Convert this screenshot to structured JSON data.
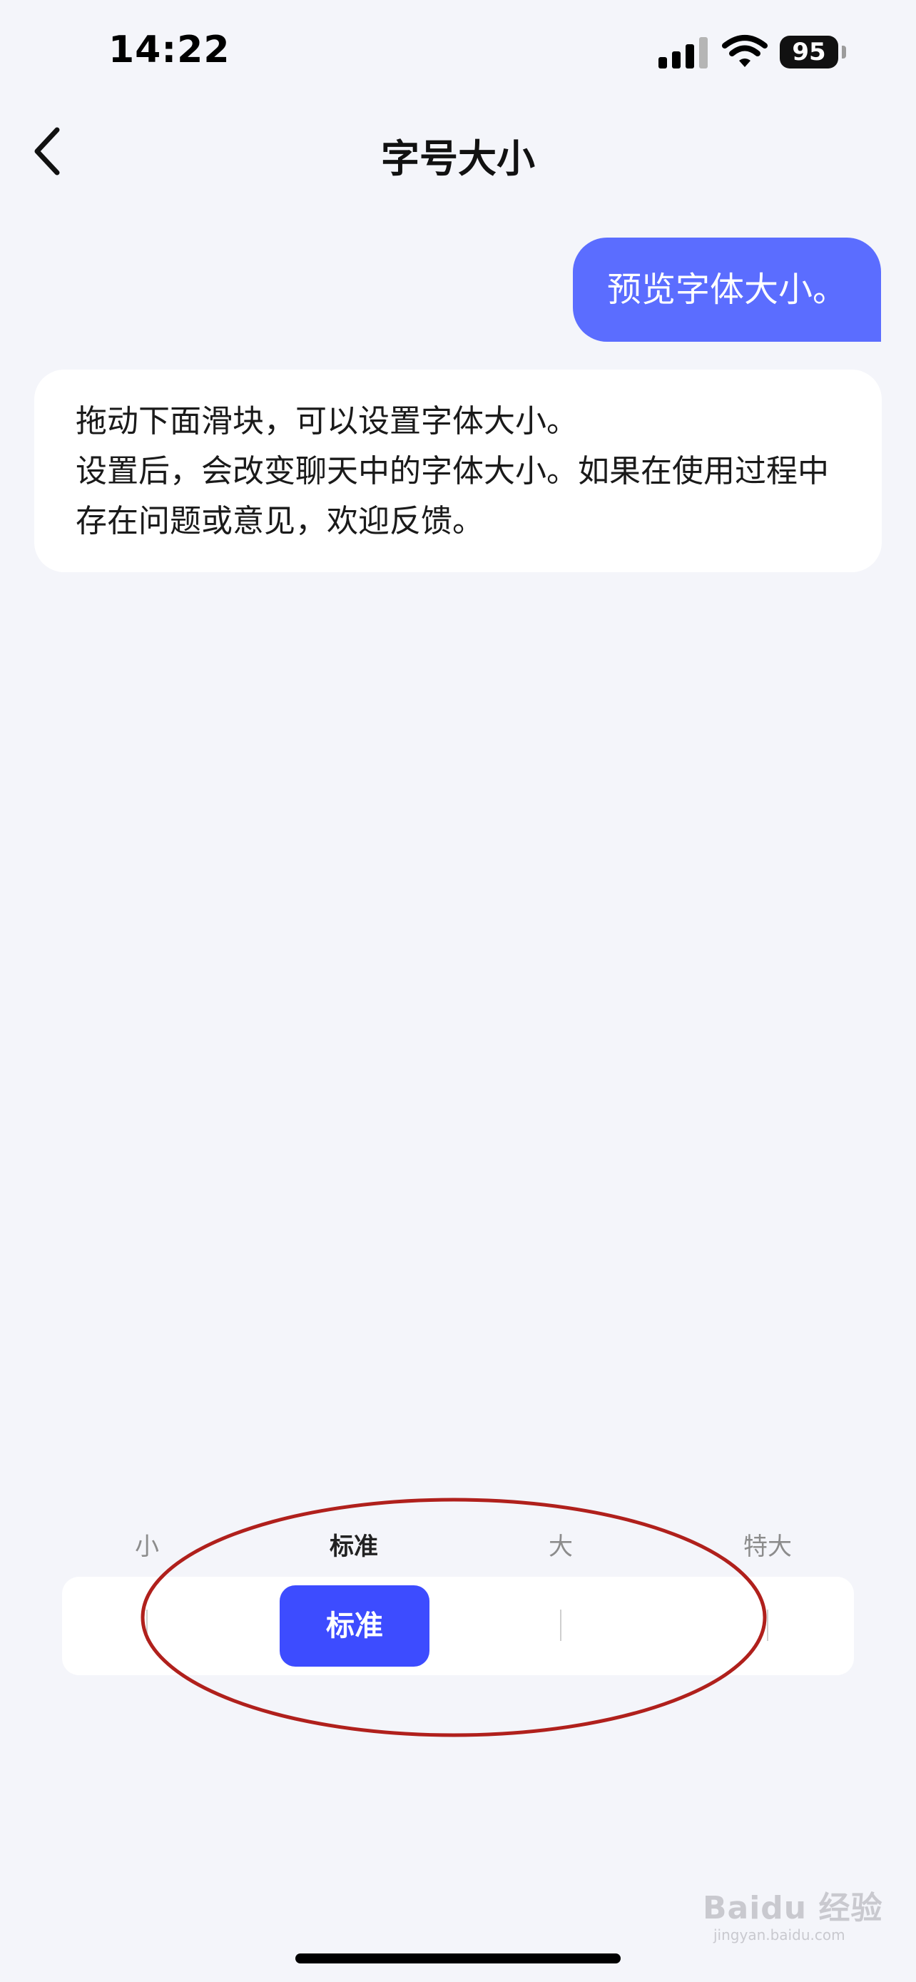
{
  "status": {
    "time": "14:22",
    "battery": "95"
  },
  "nav": {
    "title": "字号大小"
  },
  "chat": {
    "preview_bubble": "预览字体大小。",
    "info_bubble": "拖动下面滑块，可以设置字体大小。\n设置后，会改变聊天中的字体大小。如果在使用过程中存在问题或意见，欢迎反馈。"
  },
  "font_size": {
    "options": [
      "小",
      "标准",
      "大",
      "特大"
    ],
    "selected": "标准",
    "selected_index": 1
  },
  "watermark": {
    "text": "Baidu 经验",
    "sub": "jingyan.baidu.com"
  },
  "colors": {
    "accent": "#3d4cff",
    "bubble": "#5b6dff",
    "annotation": "#b0201c",
    "background": "#f4f5fa"
  }
}
